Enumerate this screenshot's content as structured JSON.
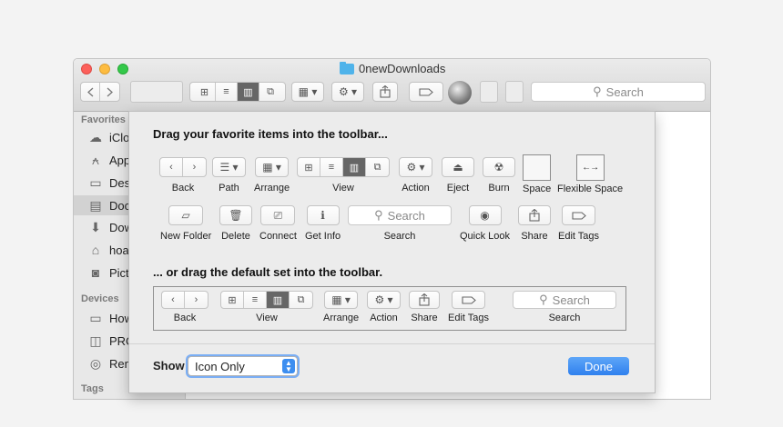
{
  "window": {
    "title": "0newDownloads",
    "search_placeholder": "Search"
  },
  "sidebar": {
    "favorites_heading": "Favorites",
    "devices_heading": "Devices",
    "tags_heading": "Tags",
    "favorites": [
      {
        "label": "iClo",
        "icon": "cloud-icon"
      },
      {
        "label": "App",
        "icon": "applications-icon"
      },
      {
        "label": "Des",
        "icon": "desktop-icon"
      },
      {
        "label": "Doc",
        "icon": "documents-icon",
        "selected": true
      },
      {
        "label": "Dow",
        "icon": "downloads-icon"
      },
      {
        "label": "hoa",
        "icon": "home-icon"
      },
      {
        "label": "Pict",
        "icon": "camera-icon"
      }
    ],
    "devices": [
      {
        "label": "How",
        "icon": "computer-icon"
      },
      {
        "label": "PRC",
        "icon": "disk-icon"
      },
      {
        "label": "Rem",
        "icon": "remote-disc-icon"
      }
    ]
  },
  "sheet": {
    "heading": "Drag your favorite items into the toolbar...",
    "default_heading": "... or drag the default set into the toolbar.",
    "items": {
      "back": "Back",
      "path": "Path",
      "arrange": "Arrange",
      "view": "View",
      "action": "Action",
      "eject": "Eject",
      "burn": "Burn",
      "space": "Space",
      "flexible_space": "Flexible Space",
      "new_folder": "New Folder",
      "delete": "Delete",
      "connect": "Connect",
      "get_info": "Get Info",
      "search": "Search",
      "quick_look": "Quick Look",
      "share": "Share",
      "edit_tags": "Edit Tags"
    },
    "search_placeholder": "Search",
    "default_set": {
      "back": "Back",
      "view": "View",
      "arrange": "Arrange",
      "action": "Action",
      "share": "Share",
      "edit_tags": "Edit Tags",
      "search": "Search",
      "search_placeholder": "Search"
    },
    "show_label": "Show",
    "show_value": "Icon Only",
    "done_label": "Done"
  },
  "colors": {
    "accent": "#2f80ee",
    "view_selected": "#666666",
    "sheet_bg": "#ececec"
  }
}
